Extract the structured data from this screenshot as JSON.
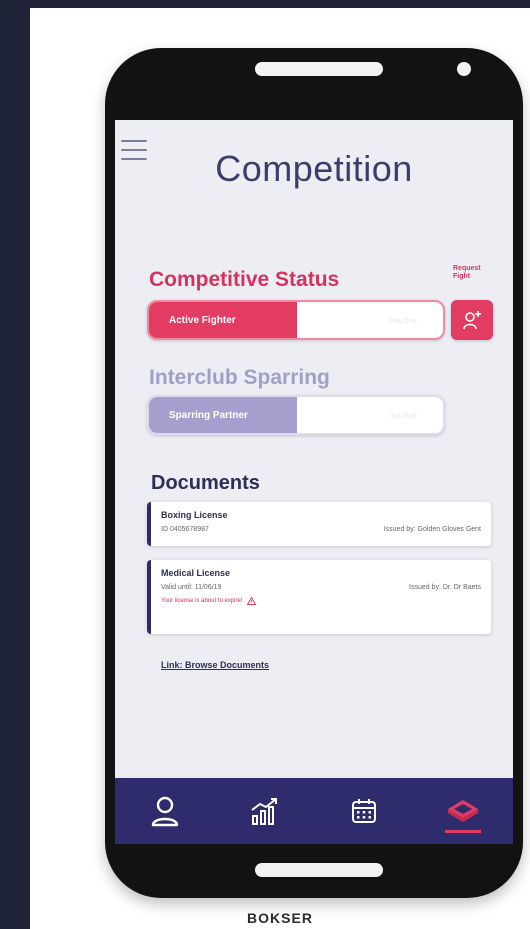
{
  "screen": {
    "title": "Competition"
  },
  "competitive": {
    "title": "Competitive Status",
    "active_label": "Active Fighter",
    "inactive_label": "Inactive",
    "request_label": "Request Fight"
  },
  "sparring": {
    "title": "Interclub Sparring",
    "active_label": "Sparring Partner",
    "inactive_label": "Inactive"
  },
  "documents": {
    "title": "Documents",
    "items": [
      {
        "name": "Boxing License",
        "id_text": "ID 0405678987",
        "issuer": "Issued by: Golden Gloves Gent"
      },
      {
        "name": "Medical License",
        "valid_text": "Valid until: 11/06/19",
        "issuer": "Issued by: Dr. Dr Baets",
        "warning": "Your license is about to expire!"
      }
    ],
    "link": "Link: Browse Documents"
  },
  "nav": {
    "items": [
      {
        "icon": "user-icon"
      },
      {
        "icon": "stats-icon"
      },
      {
        "icon": "calendar-icon"
      },
      {
        "icon": "boxing-ring-icon",
        "active": true
      }
    ]
  },
  "caption": "BOKSER",
  "colors": {
    "accent": "#e33c63",
    "navy": "#2f2c6e",
    "sparring": "#a59fcd"
  }
}
